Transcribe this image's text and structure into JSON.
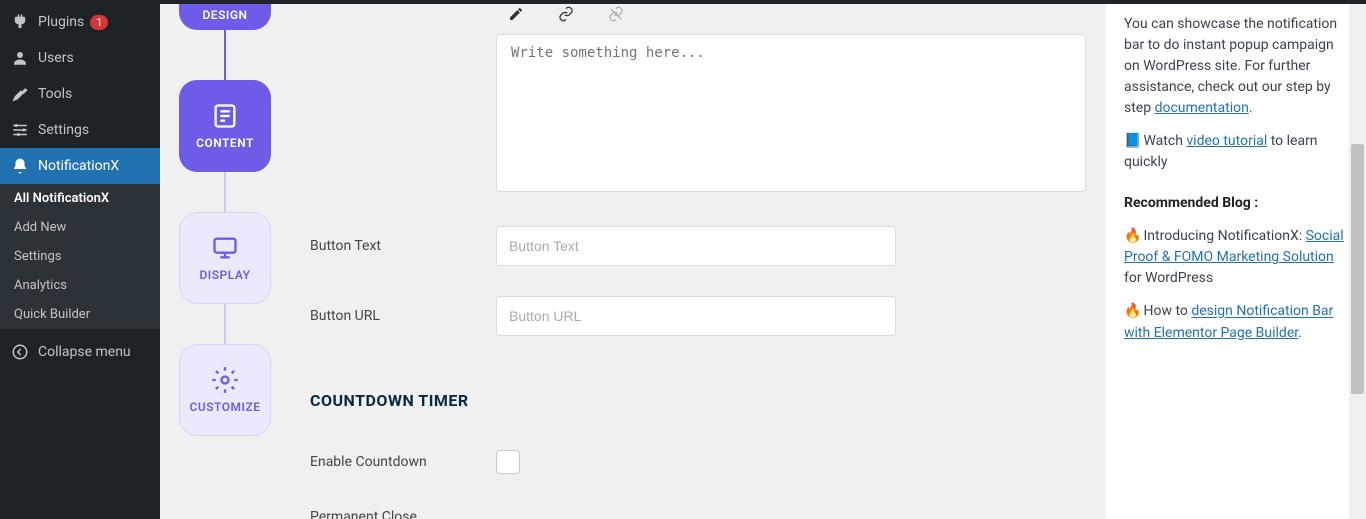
{
  "sidebar": {
    "items": [
      {
        "label": "Plugins",
        "icon": "plugin",
        "badge": "1"
      },
      {
        "label": "Users",
        "icon": "users"
      },
      {
        "label": "Tools",
        "icon": "tools"
      },
      {
        "label": "Settings",
        "icon": "settings"
      },
      {
        "label": "NotificationX",
        "icon": "bell",
        "active": true
      }
    ],
    "submenu": [
      {
        "label": "All NotificationX",
        "active": true
      },
      {
        "label": "Add New"
      },
      {
        "label": "Settings"
      },
      {
        "label": "Analytics"
      },
      {
        "label": "Quick Builder"
      }
    ],
    "collapse_label": "Collapse menu"
  },
  "steps": [
    {
      "label": "DESIGN",
      "state": "active"
    },
    {
      "label": "CONTENT",
      "state": "active"
    },
    {
      "label": "DISPLAY",
      "state": "inactive"
    },
    {
      "label": "CUSTOMIZE",
      "state": "inactive"
    }
  ],
  "editor": {
    "placeholder": "Write something here..."
  },
  "fields": {
    "button_text_label": "Button Text",
    "button_text_placeholder": "Button Text",
    "button_url_label": "Button URL",
    "button_url_placeholder": "Button URL",
    "countdown_title": "COUNTDOWN TIMER",
    "enable_countdown_label": "Enable Countdown",
    "permanent_close_label": "Permanent Close"
  },
  "help": {
    "intro_text": "You can showcase the notification bar to do instant popup campaign on WordPress site. For further assistance, check out our step by step ",
    "doc_link": "documentation",
    "watch_text": "Watch ",
    "video_link": "video tutorial",
    "watch_suffix": " to learn quickly",
    "recommended_title": "Recommended Blog :",
    "blog1_prefix": "Introducing NotificationX: ",
    "blog1_link": "Social Proof & FOMO Marketing Solution",
    "blog1_suffix": " for WordPress",
    "blog2_prefix": "How to ",
    "blog2_link": "design Notification Bar with Elementor Page Builder",
    "blog2_suffix": "."
  }
}
